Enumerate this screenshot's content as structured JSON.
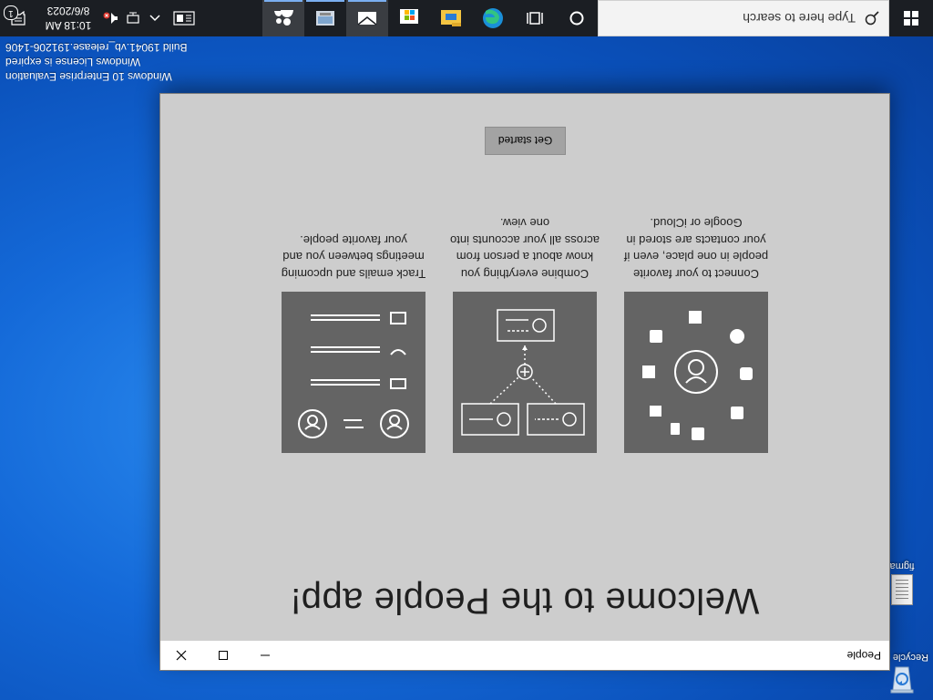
{
  "desktop": {
    "icons": [
      {
        "label": "Recycle Bin"
      },
      {
        "label": "figma"
      }
    ],
    "watermark": {
      "line1": "Windows 10 Enterprise Evaluation",
      "line2": "Windows License is expired",
      "line3": "Build 19041.vb_release.191206-1406"
    }
  },
  "window": {
    "title": "People",
    "welcome": "Welcome to the People app!",
    "features": [
      {
        "description": "Connect to your favorite people in one place, even if your contacts are stored in Google or iCloud."
      },
      {
        "description": "Combine everything you know about a person from across all your accounts into one view."
      },
      {
        "description": "Track emails and upcoming meetings between you and your favorite people."
      }
    ],
    "get_started_label": "Get started"
  },
  "taskbar": {
    "search_placeholder": "Type here to search",
    "apps": [
      {
        "icon": "cortana-icon"
      },
      {
        "icon": "task-view-icon"
      },
      {
        "icon": "edge-icon"
      },
      {
        "icon": "file-explorer-icon"
      },
      {
        "icon": "microsoft-store-icon"
      },
      {
        "icon": "mail-icon"
      },
      {
        "icon": "file-manager-icon"
      },
      {
        "icon": "people-icon"
      }
    ],
    "clock_time": "10:18 AM",
    "clock_date": "8/6/2023",
    "notification_count": "1"
  },
  "colors": {
    "window_bg": "#cdcdcd",
    "card_bg": "#646464",
    "button_bg": "#a3a3a3",
    "taskbar_bg": "#1b1e23",
    "accent": "#0078d7"
  }
}
